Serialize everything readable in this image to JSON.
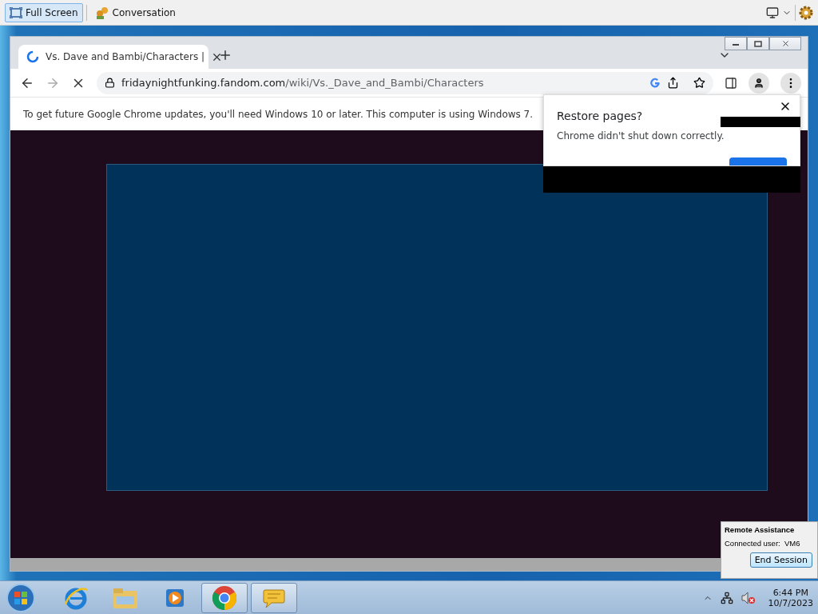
{
  "toolbar": {
    "buttons": [
      {
        "kind": "fullscreen",
        "label": "Full Screen",
        "selected": true
      },
      {
        "kind": "chat",
        "label": "Conversation",
        "selected": false
      }
    ]
  },
  "browser": {
    "tab": {
      "title": "Vs. Dave and Bambi/Characters |",
      "loading": true
    },
    "address": {
      "domain": "fridaynightfunking.fandom.com",
      "path": "/wiki/Vs._Dave_and_Bambi/Characters"
    },
    "infobar": "To get future Google Chrome updates, you'll need Windows 10 or later. This computer is using Windows 7.",
    "dialog": {
      "title": "Restore pages?",
      "message": "Chrome didn't shut down correctly."
    }
  },
  "remote_assistance": {
    "title": "Remote Assistance",
    "status": "Connected user:  VM6",
    "button": "End Session"
  },
  "taskbar": {
    "apps": [
      {
        "kind": "ie",
        "running": false
      },
      {
        "kind": "explorer",
        "running": false
      },
      {
        "kind": "media",
        "running": false
      },
      {
        "kind": "chrome",
        "running": true
      },
      {
        "kind": "chat",
        "running": true
      }
    ],
    "clock": {
      "time": "6:44 PM",
      "date": "10/7/2023"
    },
    "sound_muted": true
  }
}
